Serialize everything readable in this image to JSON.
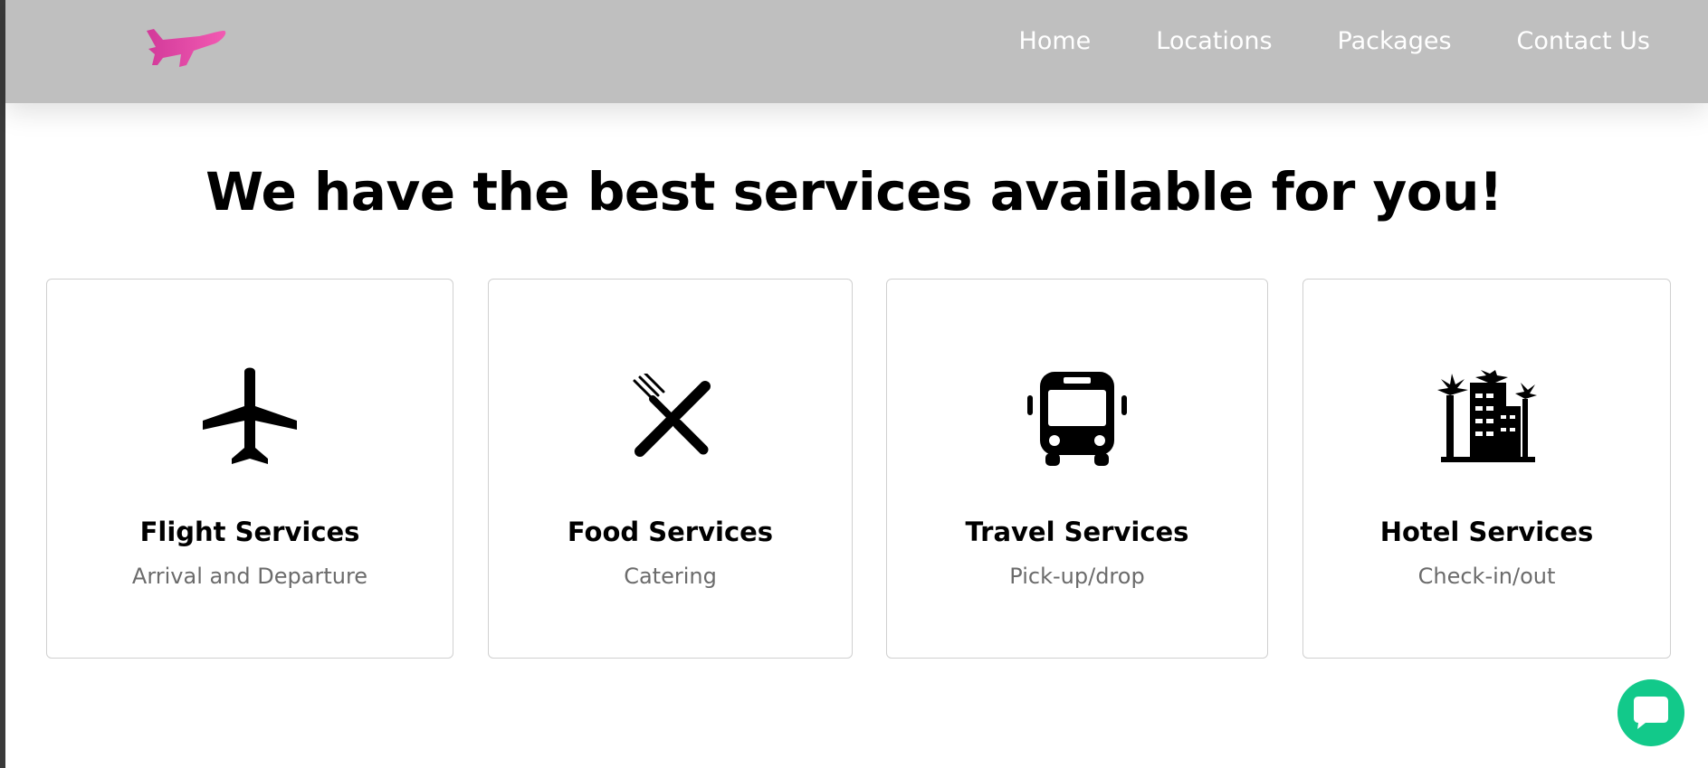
{
  "header": {
    "logo_icon": "pink-airplane-logo-icon",
    "nav": [
      {
        "label": "Home"
      },
      {
        "label": "Locations"
      },
      {
        "label": "Packages"
      },
      {
        "label": "Contact Us"
      }
    ]
  },
  "main": {
    "heading": "We have the best services available for you!",
    "services": [
      {
        "title": "Flight Services",
        "subtitle": "Arrival and Departure",
        "icon": "airplane-icon"
      },
      {
        "title": "Food Services",
        "subtitle": "Catering",
        "icon": "fork-knife-icon"
      },
      {
        "title": "Travel Services",
        "subtitle": "Pick-up/drop",
        "icon": "bus-icon"
      },
      {
        "title": "Hotel Services",
        "subtitle": "Check-in/out",
        "icon": "hotel-icon"
      }
    ]
  },
  "chat": {
    "icon": "chat-bubble-icon",
    "color": "#12c98a"
  },
  "colors": {
    "navbar": "#bfbfbf",
    "logo": "#ec4fa5",
    "nav_text": "#ffffff",
    "subtitle_text": "#6b6b6b"
  }
}
